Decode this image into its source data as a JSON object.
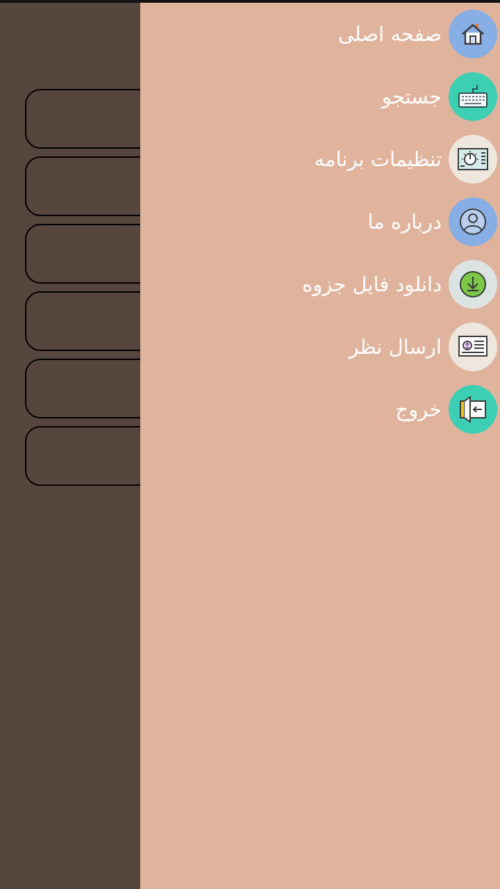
{
  "drawer": {
    "items": [
      {
        "label": "صفحه اصلی",
        "icon": "home-icon",
        "icon_bg": "#87aee5"
      },
      {
        "label": "جستجو",
        "icon": "keyboard-icon",
        "icon_bg": "#3ccfb4"
      },
      {
        "label": "تنظیمات برنامه",
        "icon": "settings-panel-icon",
        "icon_bg": "#ede7de"
      },
      {
        "label": "درباره ما",
        "icon": "user-profile-icon",
        "icon_bg": "#87aee5"
      },
      {
        "label": "دانلود فایل جزوه",
        "icon": "download-icon",
        "icon_bg": "#dce3e3"
      },
      {
        "label": "ارسال نظر",
        "icon": "id-card-icon",
        "icon_bg": "#ede7de"
      },
      {
        "label": "خروج",
        "icon": "exit-icon",
        "icon_bg": "#3ccfb4"
      }
    ]
  },
  "colors": {
    "drawer_bg": "#e0b39d",
    "scrim_bg": "#56473e",
    "label_text": "#ffffff"
  }
}
